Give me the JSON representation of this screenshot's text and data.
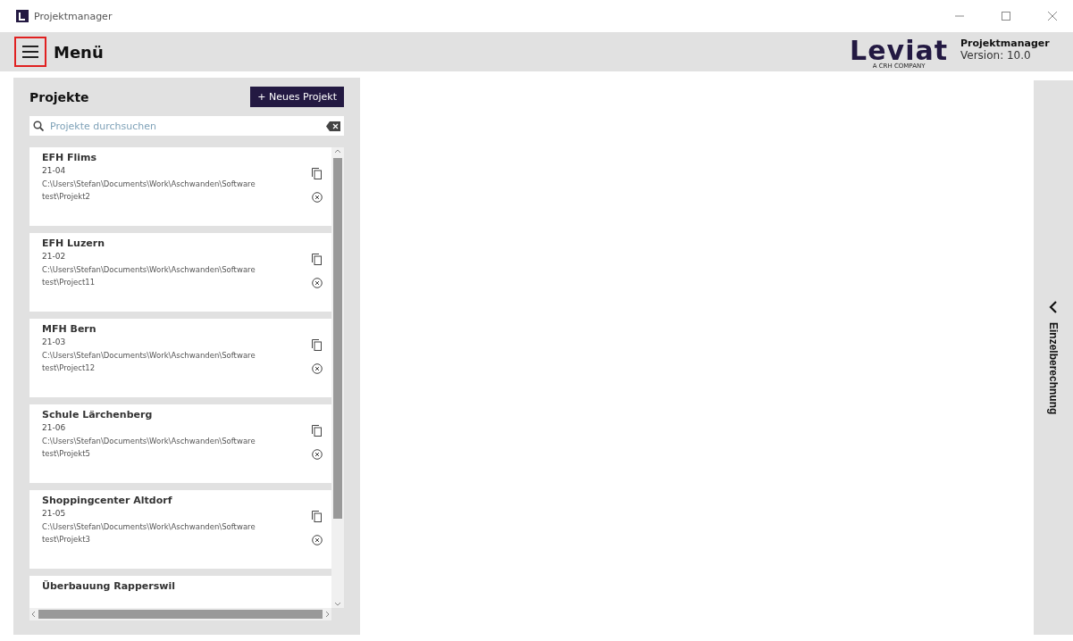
{
  "window": {
    "title": "Projektmanager"
  },
  "header": {
    "menu_label": "Menü",
    "logo_word": "Leviat",
    "logo_tagline": "A CRH COMPANY",
    "app_name": "Projektmanager",
    "version": "Version: 10.0"
  },
  "projects_panel": {
    "title": "Projekte",
    "new_button": "+ Neues Projekt",
    "search": {
      "placeholder": "Projekte durchsuchen"
    },
    "projects": [
      {
        "name": "EFH Flims",
        "number": "21-04",
        "path": "C:\\Users\\Stefan\\Documents\\Work\\Aschwanden\\Software test\\Projekt2"
      },
      {
        "name": "EFH Luzern",
        "number": "21-02",
        "path": "C:\\Users\\Stefan\\Documents\\Work\\Aschwanden\\Software test\\Project11"
      },
      {
        "name": "MFH Bern",
        "number": "21-03",
        "path": "C:\\Users\\Stefan\\Documents\\Work\\Aschwanden\\Software test\\Project12"
      },
      {
        "name": "Schule Lärchenberg",
        "number": "21-06",
        "path": "C:\\Users\\Stefan\\Documents\\Work\\Aschwanden\\Software test\\Projekt5"
      },
      {
        "name": "Shoppingcenter Altdorf",
        "number": "21-05",
        "path": "C:\\Users\\Stefan\\Documents\\Work\\Aschwanden\\Software test\\Projekt3"
      },
      {
        "name": "Überbauung Rapperswil"
      }
    ]
  },
  "side_panel": {
    "label": "Einzelberechnung",
    "expanded": false
  }
}
